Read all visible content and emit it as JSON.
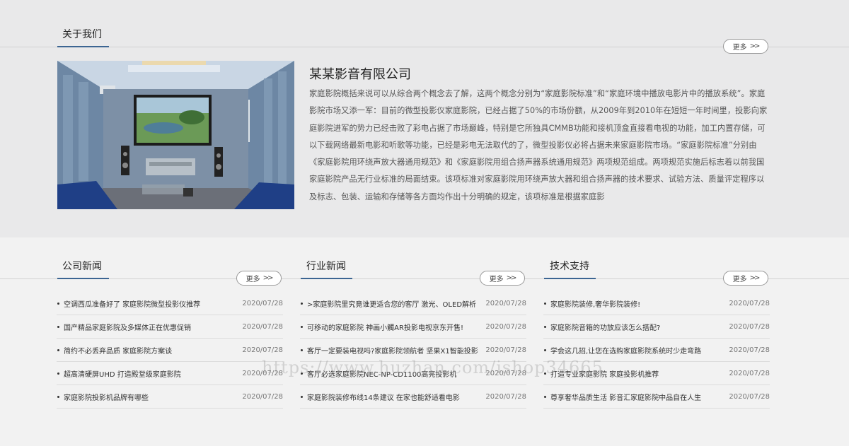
{
  "about": {
    "title": "关于我们",
    "more_label": "更多",
    "company_name": "某某影音有限公司",
    "description": "家庭影院概括来说可以从综合两个概念去了解，这两个概念分别为“家庭影院标准”和“家庭环境中播放电影片中的播放系统”。家庭影院市场又添一军：目前的微型投影仪家庭影院，已经占据了50%的市场份额，从2009年到2010年在短短一年时间里，投影向家庭影院进军的势力已经击败了彩电占据了市场巅峰，特别是它所独具CMMB功能和接机顶盒直接看电视的功能，加工内置存储，可以下载网络最新电影和听歌等功能，已经是彩电无法取代的了，微型投影仪必将占据未来家庭影院市场。“家庭影院标准”分别由《家庭影院用环绕声放大器通用规范》和《家庭影院用组合扬声器系统通用规范》两项规范组成。两项规范实施后标志着以前我国家庭影院产品无行业标准的局面结束。该项标准对家庭影院用环绕声放大器和组合扬声器的技术要求、试验方法、质量评定程序以及标志、包装、运输和存储等各方面均作出十分明确的规定，该项标准是根据家庭影"
  },
  "columns": [
    {
      "title": "公司新闻",
      "more_label": "更多",
      "items": [
        {
          "title": "空调西瓜准备好了 家庭影院微型投影仪推荐",
          "date": "2020/07/28"
        },
        {
          "title": "国产精品家庭影院及多媒体正在优惠促销",
          "date": "2020/07/28"
        },
        {
          "title": "简约不必丢弃品质 家庭影院方案谈",
          "date": "2020/07/28"
        },
        {
          "title": "超高清硬屏UHD 打造殿堂级家庭影院",
          "date": "2020/07/28"
        },
        {
          "title": "家庭影院投影机品牌有哪些",
          "date": "2020/07/28"
        }
      ]
    },
    {
      "title": "行业新闻",
      "more_label": "更多",
      "items": [
        {
          "title": ">家庭影院里究竟谁更适合您的客厅 激光、OLED解析",
          "date": "2020/07/28"
        },
        {
          "title": "可移动的家庭影院 神画小觸AR投影电视京东开售!",
          "date": "2020/07/28"
        },
        {
          "title": "客厅一定要装电视吗?家庭影院领航者 坚果X1智能投影",
          "date": "2020/07/28"
        },
        {
          "title": "客厅必选家庭影院NEC-NP-CD1100高亮投影机",
          "date": "2020/07/28"
        },
        {
          "title": "家庭影院装修布线14条建议 在家也能舒适看电影",
          "date": "2020/07/28"
        }
      ]
    },
    {
      "title": "技术支持",
      "more_label": "更多",
      "items": [
        {
          "title": "家庭影院装修,奢华影院装修!",
          "date": "2020/07/28"
        },
        {
          "title": "家庭影院音箱的功放应该怎么搭配?",
          "date": "2020/07/28"
        },
        {
          "title": "学会这几招,让您在选购家庭影院系统时少走弯路",
          "date": "2020/07/28"
        },
        {
          "title": "打造专业家庭影院 家庭投影机推荐",
          "date": "2020/07/28"
        },
        {
          "title": "尊享奢华品质生活 影音汇家庭影院中品自在人生",
          "date": "2020/07/28"
        }
      ]
    }
  ],
  "watermark": "https://www.huzhan.com/ishop34665",
  "colors": {
    "accent_line": "#3c6592",
    "about_bg": "#e9e9ea",
    "page_bg": "#f2f2f2"
  }
}
